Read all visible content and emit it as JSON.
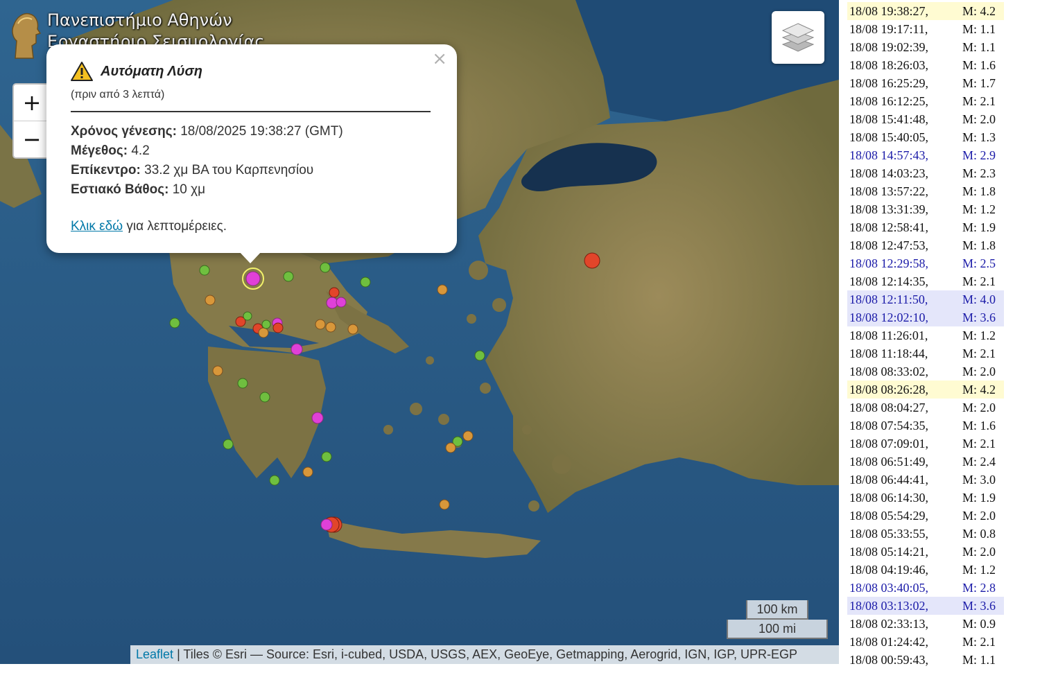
{
  "logo": {
    "line1": "Πανεπιστήμιο Αθηνών",
    "line2": "Εργαστήριο Σεισμολογίας"
  },
  "zoom": {
    "in": "+",
    "out": "−"
  },
  "popup": {
    "close": "×",
    "title": "Αυτόματη Λύση",
    "ago": "(πριν από 3 λεπτά)",
    "rows": [
      {
        "label": "Χρόνος γένεσης:",
        "value": "18/08/2025 19:38:27 (GMT)"
      },
      {
        "label": "Μέγεθος:",
        "value": "4.2"
      },
      {
        "label": "Επίκεντρο:",
        "value": "33.2 χμ ΒΑ του Καρπενησίου"
      },
      {
        "label": "Εστιακό Βάθος:",
        "value": "10 χμ"
      }
    ],
    "link_text": "Κλικ εδώ",
    "link_suffix": "για λεπτομέρειες."
  },
  "scale": {
    "km": "100 km",
    "mi": "100 mi"
  },
  "attribution": {
    "leaflet": "Leaflet",
    "text": "| Tiles © Esri — Source: Esri, i-cubed, USDA, USGS, AEX, GeoEye, Getmapping, Aerogrid, IGN, IGP, UPR-EGP"
  },
  "events": [
    {
      "time": "18/08 19:38:27,",
      "mag": "M: 4.2",
      "style": "hl-y"
    },
    {
      "time": "18/08 19:17:11,",
      "mag": "M: 1.1",
      "style": ""
    },
    {
      "time": "18/08 19:02:39,",
      "mag": "M: 1.1",
      "style": ""
    },
    {
      "time": "18/08 18:26:03,",
      "mag": "M: 1.6",
      "style": ""
    },
    {
      "time": "18/08 16:25:29,",
      "mag": "M: 1.7",
      "style": ""
    },
    {
      "time": "18/08 16:12:25,",
      "mag": "M: 2.1",
      "style": ""
    },
    {
      "time": "18/08 15:41:48,",
      "mag": "M: 2.0",
      "style": ""
    },
    {
      "time": "18/08 15:40:05,",
      "mag": "M: 1.3",
      "style": ""
    },
    {
      "time": "18/08 14:57:43,",
      "mag": "M: 2.9",
      "style": "blue"
    },
    {
      "time": "18/08 14:03:23,",
      "mag": "M: 2.3",
      "style": ""
    },
    {
      "time": "18/08 13:57:22,",
      "mag": "M: 1.8",
      "style": ""
    },
    {
      "time": "18/08 13:31:39,",
      "mag": "M: 1.2",
      "style": ""
    },
    {
      "time": "18/08 12:58:41,",
      "mag": "M: 1.9",
      "style": ""
    },
    {
      "time": "18/08 12:47:53,",
      "mag": "M: 1.8",
      "style": ""
    },
    {
      "time": "18/08 12:29:58,",
      "mag": "M: 2.5",
      "style": "blue"
    },
    {
      "time": "18/08 12:14:35,",
      "mag": "M: 2.1",
      "style": ""
    },
    {
      "time": "18/08 12:11:50,",
      "mag": "M: 4.0",
      "style": "hl-b"
    },
    {
      "time": "18/08 12:02:10,",
      "mag": "M: 3.6",
      "style": "hl-b"
    },
    {
      "time": "18/08 11:26:01,",
      "mag": "M: 1.2",
      "style": ""
    },
    {
      "time": "18/08 11:18:44,",
      "mag": "M: 2.1",
      "style": ""
    },
    {
      "time": "18/08 08:33:02,",
      "mag": "M: 2.0",
      "style": ""
    },
    {
      "time": "18/08 08:26:28,",
      "mag": "M: 4.2",
      "style": "hl-y"
    },
    {
      "time": "18/08 08:04:27,",
      "mag": "M: 2.0",
      "style": ""
    },
    {
      "time": "18/08 07:54:35,",
      "mag": "M: 1.6",
      "style": ""
    },
    {
      "time": "18/08 07:09:01,",
      "mag": "M: 2.1",
      "style": ""
    },
    {
      "time": "18/08 06:51:49,",
      "mag": "M: 2.4",
      "style": ""
    },
    {
      "time": "18/08 06:44:41,",
      "mag": "M: 3.0",
      "style": ""
    },
    {
      "time": "18/08 06:14:30,",
      "mag": "M: 1.9",
      "style": ""
    },
    {
      "time": "18/08 05:54:29,",
      "mag": "M: 2.0",
      "style": ""
    },
    {
      "time": "18/08 05:33:55,",
      "mag": "M: 0.8",
      "style": ""
    },
    {
      "time": "18/08 05:14:21,",
      "mag": "M: 2.0",
      "style": ""
    },
    {
      "time": "18/08 04:19:46,",
      "mag": "M: 1.2",
      "style": ""
    },
    {
      "time": "18/08 03:40:05,",
      "mag": "M: 2.8",
      "style": "blue"
    },
    {
      "time": "18/08 03:13:02,",
      "mag": "M: 3.6",
      "style": "hl-b"
    },
    {
      "time": "18/08 02:33:13,",
      "mag": "M: 0.9",
      "style": ""
    },
    {
      "time": "18/08 01:24:42,",
      "mag": "M: 2.1",
      "style": ""
    },
    {
      "time": "18/08 00:59:43,",
      "mag": "M: 1.1",
      "style": ""
    }
  ],
  "colors": {
    "green": "#6fbf3f",
    "orange": "#d8973a",
    "red": "#e2452a",
    "magenta": "#e040d8",
    "sea": "#2c5e86",
    "land": "#8a7a4e"
  },
  "icons": {
    "layers": "layers-icon",
    "warning": "warning-icon",
    "logo": "athena-logo-icon"
  }
}
